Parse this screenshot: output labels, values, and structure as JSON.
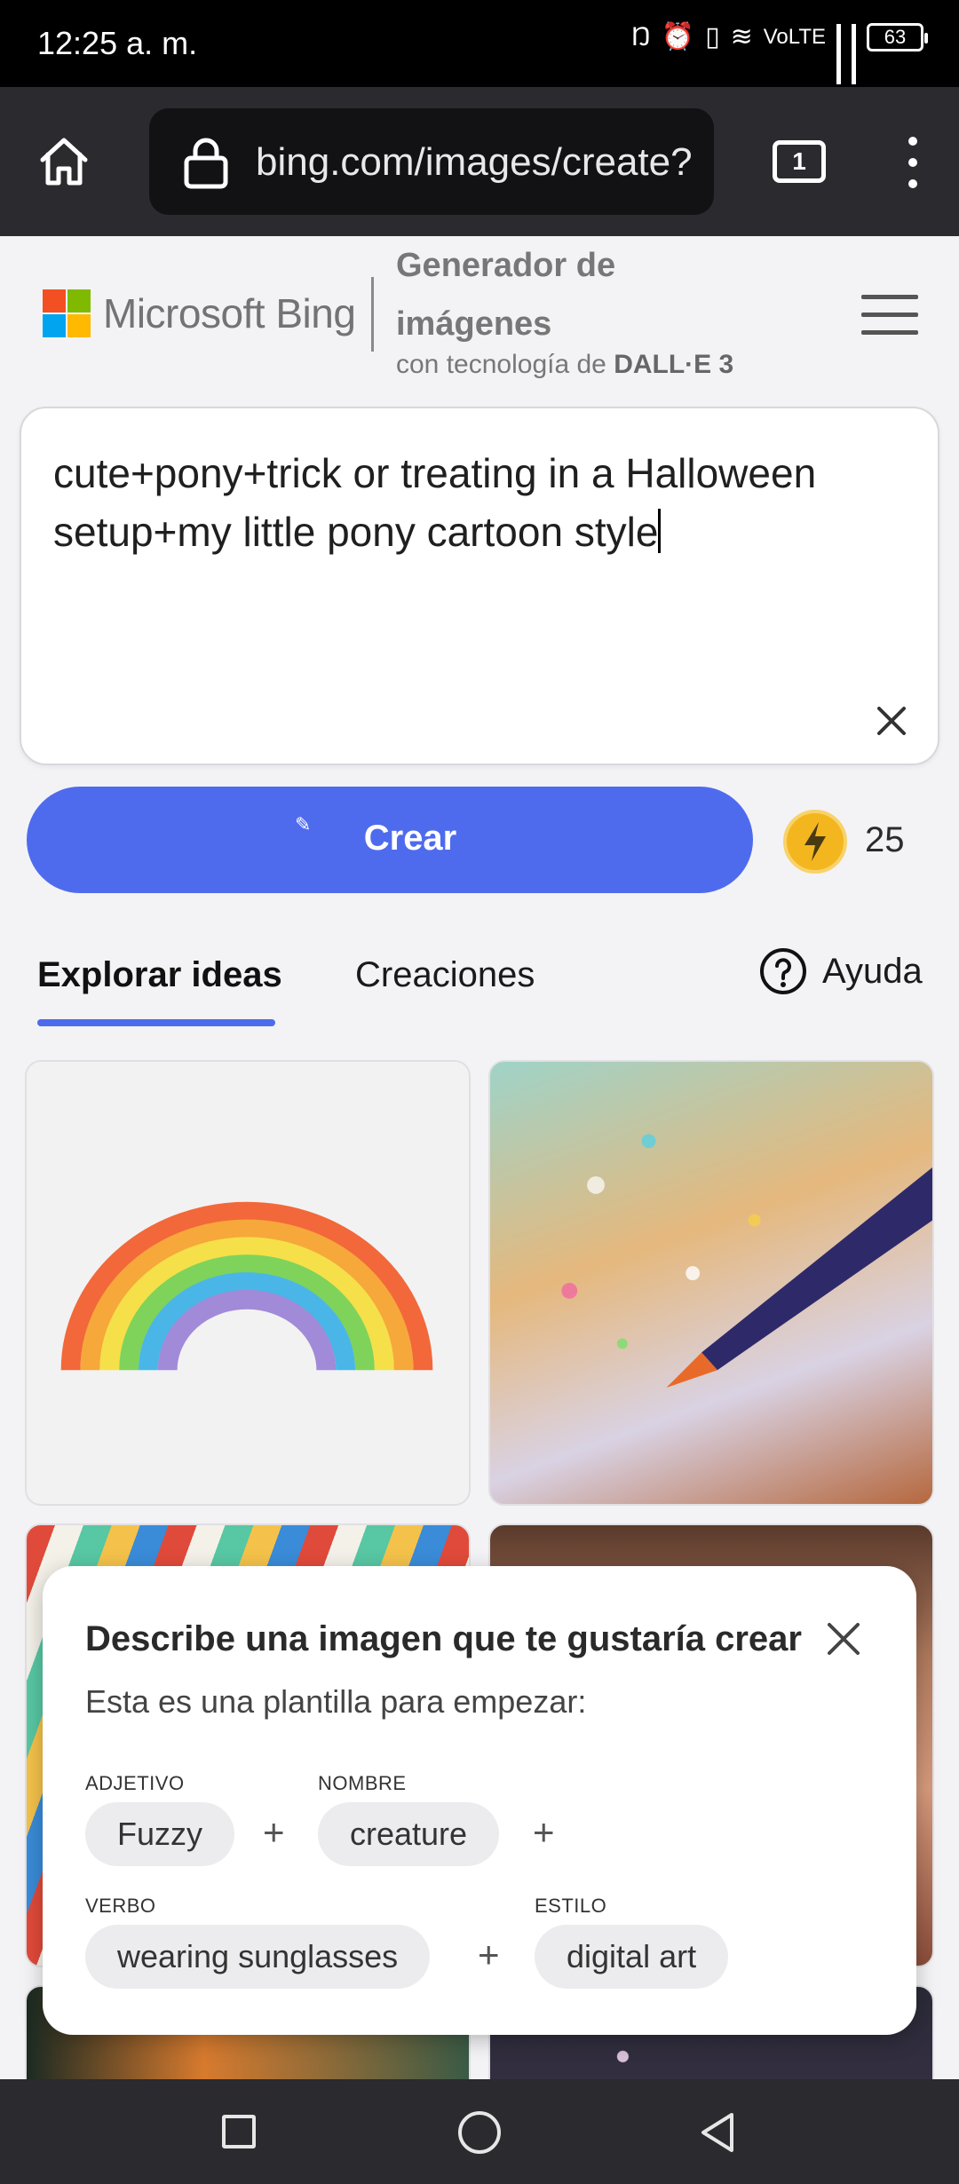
{
  "status_bar": {
    "time": "12:25 a. m.",
    "network": "VoLTE",
    "battery": "63"
  },
  "browser": {
    "url": "bing.com/images/create?",
    "tab_count": "1"
  },
  "header": {
    "brand": "Microsoft Bing",
    "product_title": "Generador de imágenes",
    "powered_prefix": "con tecnología de ",
    "powered_by": "DALL·E 3"
  },
  "prompt": {
    "text": "cute+pony+trick or treating in a Halloween setup+my little pony cartoon style"
  },
  "create": {
    "label": "Crear",
    "boosts": "25"
  },
  "tabs": {
    "explore": "Explorar ideas",
    "creations": "Creaciones",
    "help": "Ayuda"
  },
  "popup": {
    "title": "Describe una imagen que te gustaría crear",
    "subtitle": "Esta es una plantilla para empezar:",
    "adjective_label": "ADJETIVO",
    "adjective": "Fuzzy",
    "noun_label": "NOMBRE",
    "noun": "creature",
    "verb_label": "VERBO",
    "verb": "wearing sunglasses",
    "style_label": "ESTILO",
    "style": "digital art",
    "plus": "+"
  },
  "colors": {
    "accent": "#4f6bed",
    "brand_red": "#f25022",
    "brand_green": "#7fba00",
    "brand_blue": "#00a4ef",
    "brand_yellow": "#ffb900",
    "coin": "#f3b61f"
  }
}
